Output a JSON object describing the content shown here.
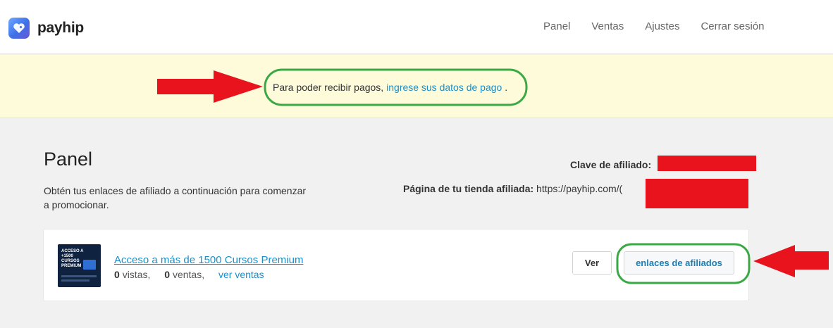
{
  "header": {
    "brand": "payhip",
    "nav": [
      "Panel",
      "Ventas",
      "Ajustes",
      "Cerrar sesión"
    ]
  },
  "notice": {
    "text_before": "Para poder recibir pagos, ",
    "link": "ingrese sus datos de pago",
    "text_after": " ."
  },
  "panel": {
    "title": "Panel",
    "description": "Obtén tus enlaces de afiliado a continuación para comenzar a promocionar.",
    "affiliate_key_label": "Clave de afiliado:",
    "affiliate_store_label": "Página de tu tienda afiliada:",
    "affiliate_store_url": "https://payhip.com/("
  },
  "product": {
    "thumb_text": "ACCESO A +1500 CURSOS PREMIUM",
    "title": "Acceso a más de 1500 Cursos Premium",
    "views_count": "0",
    "views_label": "vistas,",
    "sales_count": "0",
    "sales_label": "ventas,",
    "sales_link": "ver ventas",
    "view_button": "Ver",
    "affiliate_button": "enlaces de afiliados"
  },
  "colors": {
    "link": "#1a8fc9",
    "notice_bg": "#fdfbd9",
    "annotation_red": "#e8131c",
    "annotation_green": "#3aa845"
  }
}
